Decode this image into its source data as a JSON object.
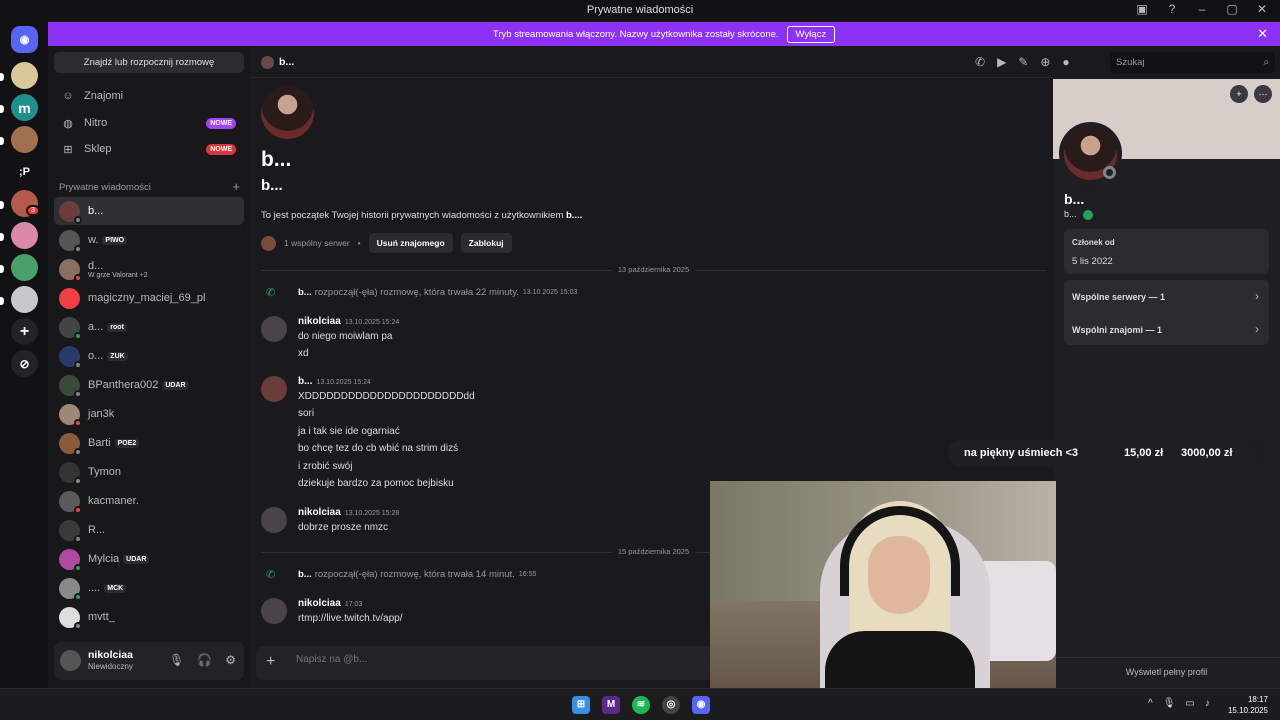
{
  "window": {
    "title": "Prywatne wiadomości"
  },
  "banner": {
    "text": "Tryb streamowania włączony. Nazwy użytkownika zostały skrócone.",
    "button": "Wyłącz"
  },
  "sidebar": {
    "search_label": "Znajdź lub rozpocznij rozmowę",
    "nav": [
      {
        "label": "Znajomi",
        "icon": "friends-icon"
      },
      {
        "label": "Nitro",
        "icon": "nitro-icon",
        "badge": "NOWE"
      },
      {
        "label": "Sklep",
        "icon": "shop-icon",
        "badge": "NOWE"
      }
    ],
    "dm_header": "Prywatne wiadomości",
    "dms": [
      {
        "name": "b...",
        "tag": "",
        "sub": ""
      },
      {
        "name": "w.",
        "tag": "PIWO",
        "sub": ""
      },
      {
        "name": "d...",
        "tag": "",
        "sub": "W grze Valorant +2"
      },
      {
        "name": "magiczny_maciej_69_pl",
        "tag": "",
        "sub": ""
      },
      {
        "name": "a...",
        "tag": "root",
        "sub": ""
      },
      {
        "name": "o...",
        "tag": "ZUK",
        "sub": ""
      },
      {
        "name": "BPanthera002",
        "tag": "UDAR",
        "sub": ""
      },
      {
        "name": "jan3k",
        "tag": "",
        "sub": ""
      },
      {
        "name": "Barti",
        "tag": "POE2",
        "sub": ""
      },
      {
        "name": "Tymon",
        "tag": "",
        "sub": ""
      },
      {
        "name": "kacmaner.",
        "tag": "",
        "sub": ""
      },
      {
        "name": "R...",
        "tag": "",
        "sub": ""
      },
      {
        "name": "Mylcia",
        "tag": "UDAR",
        "sub": ""
      },
      {
        "name": "....",
        "tag": "MCK",
        "sub": ""
      },
      {
        "name": "mvtt_",
        "tag": "",
        "sub": ""
      }
    ],
    "user": {
      "name": "nikolciaa",
      "status": "Niewidoczny"
    }
  },
  "rail": {
    "dm_badge": "3",
    "text_server": ";P"
  },
  "chat": {
    "header_name": "b...",
    "search_placeholder": "Szukaj",
    "intro": {
      "big_name": "b...",
      "sub_name": "b...",
      "text_prefix": "To jest początek Twojej historii prywatnych wiadomości z użytkownikiem",
      "text_name": "b....",
      "mutual": "1 wspólny serwer",
      "remove_friend": "Usuń znajomego",
      "block": "Zablokuj"
    },
    "dividers": [
      "13 października 2025",
      "15 października 2025"
    ],
    "calls": [
      {
        "name": "b...",
        "text": "rozpoczął(-ęła) rozmowę, która trwała 22 minuty.",
        "time": "13.10.2025 15:03"
      },
      {
        "name": "b...",
        "text": "rozpoczął(-ęła) rozmowę, która trwała 14 minut.",
        "time": "16:55"
      }
    ],
    "messages": [
      {
        "author": "nikolciaa",
        "time": "13.10.2025 15:24",
        "lines": [
          "do niego moiwlam pa",
          "xd"
        ]
      },
      {
        "author": "b...",
        "time": "13.10.2025 15:24",
        "lines": [
          "XDDDDDDDDDDDDDDDDDDDDDDdd",
          "sori",
          "ja i tak sie ide ogarniać",
          "bo chcę tez do cb wbić na strim dizś",
          "i zrobić swój",
          "dziekuje bardzo za pomoc bejbisku"
        ]
      },
      {
        "author": "nikolciaa",
        "time": "13.10.2025 15:28",
        "lines": [
          "dobrze prosze nmzc"
        ]
      },
      {
        "author": "nikolciaa",
        "time": "17:03",
        "lines": [
          "rtmp://live.twitch.tv/app/"
        ]
      }
    ],
    "composer_placeholder": "Napisz na @b..."
  },
  "profile": {
    "name": "b...",
    "handle": "b...",
    "member_label": "Członek od",
    "member_since": "5 lis 2022",
    "mutual_servers": "Wspólne serwery — 1",
    "mutual_friends": "Wspólni znajomi — 1",
    "view_full": "Wyświetl pełny profil"
  },
  "overlay": {
    "donation_text": "na piękny uśmiech <3",
    "amount": "15,00 zł",
    "goal": "3000,00 zł"
  },
  "taskbar": {
    "time": "18:17",
    "date": "15.10.2025"
  },
  "colors": {
    "accent": "#8b32f5",
    "online": "#23a55a",
    "danger": "#da373c"
  }
}
